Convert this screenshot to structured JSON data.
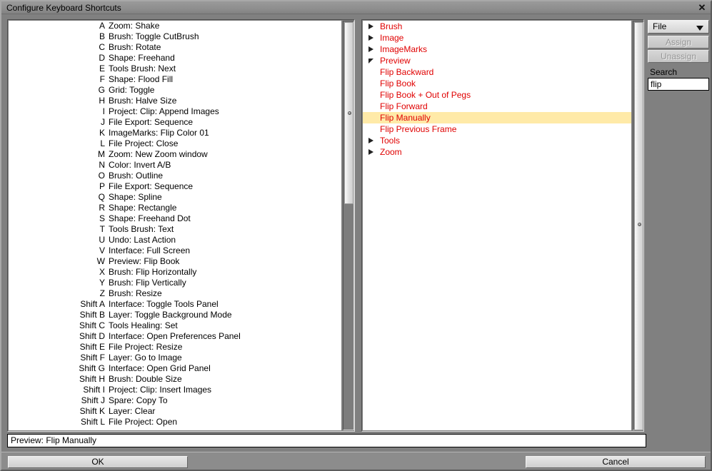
{
  "window": {
    "title": "Configure Keyboard Shortcuts",
    "close_icon": "close-icon"
  },
  "shortcut_list": {
    "rows": [
      {
        "key": "A",
        "desc": "Zoom: Shake"
      },
      {
        "key": "B",
        "desc": "Brush: Toggle CutBrush"
      },
      {
        "key": "C",
        "desc": "Brush: Rotate"
      },
      {
        "key": "D",
        "desc": "Shape: Freehand"
      },
      {
        "key": "E",
        "desc": "Tools Brush: Next"
      },
      {
        "key": "F",
        "desc": "Shape: Flood Fill"
      },
      {
        "key": "G",
        "desc": "Grid: Toggle"
      },
      {
        "key": "H",
        "desc": "Brush: Halve Size"
      },
      {
        "key": "I",
        "desc": "Project: Clip: Append Images"
      },
      {
        "key": "J",
        "desc": "File Export: Sequence"
      },
      {
        "key": "K",
        "desc": "ImageMarks: Flip Color 01"
      },
      {
        "key": "L",
        "desc": "File Project: Close"
      },
      {
        "key": "M",
        "desc": "Zoom: New Zoom window"
      },
      {
        "key": "N",
        "desc": "Color: Invert A/B"
      },
      {
        "key": "O",
        "desc": "Brush: Outline"
      },
      {
        "key": "P",
        "desc": "File Export: Sequence"
      },
      {
        "key": "Q",
        "desc": "Shape: Spline"
      },
      {
        "key": "R",
        "desc": "Shape: Rectangle"
      },
      {
        "key": "S",
        "desc": "Shape: Freehand Dot"
      },
      {
        "key": "T",
        "desc": "Tools Brush: Text"
      },
      {
        "key": "U",
        "desc": "Undo: Last Action"
      },
      {
        "key": "V",
        "desc": "Interface: Full Screen"
      },
      {
        "key": "W",
        "desc": "Preview: Flip Book"
      },
      {
        "key": "X",
        "desc": "Brush: Flip Horizontally"
      },
      {
        "key": "Y",
        "desc": "Brush: Flip Vertically"
      },
      {
        "key": "Z",
        "desc": "Brush: Resize"
      },
      {
        "key": "Shift A",
        "desc": "Interface: Toggle Tools Panel"
      },
      {
        "key": "Shift B",
        "desc": "Layer: Toggle Background Mode"
      },
      {
        "key": "Shift C",
        "desc": "Tools Healing: Set"
      },
      {
        "key": "Shift D",
        "desc": "Interface: Open Preferences Panel"
      },
      {
        "key": "Shift E",
        "desc": "File Project: Resize"
      },
      {
        "key": "Shift F",
        "desc": "Layer: Go to Image"
      },
      {
        "key": "Shift G",
        "desc": "Interface: Open Grid Panel"
      },
      {
        "key": "Shift H",
        "desc": "Brush: Double Size"
      },
      {
        "key": "Shift I",
        "desc": "Project: Clip: Insert Images"
      },
      {
        "key": "Shift J",
        "desc": "Spare: Copy To"
      },
      {
        "key": "Shift K",
        "desc": "Layer: Clear"
      },
      {
        "key": "Shift L",
        "desc": "File Project: Open"
      }
    ]
  },
  "command_tree": {
    "rows": [
      {
        "label": "Brush",
        "level": 0,
        "state": "collapsed",
        "selected": false
      },
      {
        "label": "Image",
        "level": 0,
        "state": "collapsed",
        "selected": false
      },
      {
        "label": "ImageMarks",
        "level": 0,
        "state": "collapsed",
        "selected": false
      },
      {
        "label": "Preview",
        "level": 0,
        "state": "expanded",
        "selected": false
      },
      {
        "label": "Flip Backward",
        "level": 1,
        "state": "leaf",
        "selected": false
      },
      {
        "label": "Flip Book",
        "level": 1,
        "state": "leaf",
        "selected": false
      },
      {
        "label": "Flip Book + Out of Pegs",
        "level": 1,
        "state": "leaf",
        "selected": false
      },
      {
        "label": "Flip Forward",
        "level": 1,
        "state": "leaf",
        "selected": false
      },
      {
        "label": "Flip Manually",
        "level": 1,
        "state": "leaf",
        "selected": true
      },
      {
        "label": "Flip Previous Frame",
        "level": 1,
        "state": "leaf",
        "selected": false
      },
      {
        "label": "Tools",
        "level": 0,
        "state": "collapsed",
        "selected": false
      },
      {
        "label": "Zoom",
        "level": 0,
        "state": "collapsed",
        "selected": false
      }
    ],
    "text_color": "#e00000",
    "selected_background": "#ffeaa8"
  },
  "controls": {
    "scope_select": {
      "value": "File",
      "caret_icon": "chevron-down-icon"
    },
    "assign_label": "Assign",
    "unassign_label": "Unassign",
    "search_label": "Search",
    "search_value": "flip",
    "search_placeholder": ""
  },
  "status": {
    "text": "Preview: Flip Manually"
  },
  "buttons": {
    "ok_label": "OK",
    "cancel_label": "Cancel"
  }
}
